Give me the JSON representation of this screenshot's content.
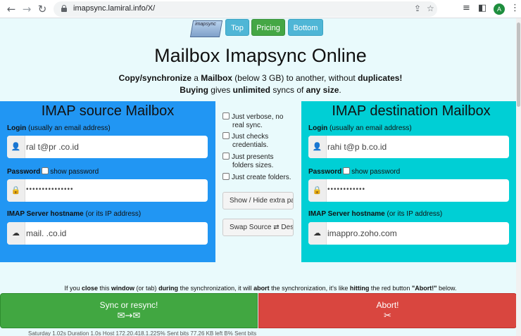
{
  "browser": {
    "url": "imapsync.lamiral.info/X/",
    "avatar_letter": "A"
  },
  "topbar": {
    "logo_text": "imapsync",
    "top": "Top",
    "pricing": "Pricing",
    "bottom": "Bottom"
  },
  "title": "Mailbox Imapsync Online",
  "subtitle": {
    "line1_a": "Copy/synchronize",
    "line1_b": " a ",
    "line1_c": "Mailbox",
    "line1_d": " (below 3 GB) to another, without ",
    "line1_e": "duplicates!",
    "line2_a": "Buying",
    "line2_b": " gives ",
    "line2_c": "unlimited",
    "line2_d": " syncs of ",
    "line2_e": "any size",
    "line2_f": "."
  },
  "source": {
    "title": "IMAP source Mailbox",
    "login_label": "Login",
    "login_hint": " (usually an email address)",
    "login_value": "ral      t@pr        .co.id",
    "password_label": "Password",
    "show_password": "show password",
    "password_value": "•••••••••••••••",
    "host_label": "IMAP Server hostname",
    "host_hint": " (or its IP address)",
    "host_value": "mail.              .co.id"
  },
  "destination": {
    "title": "IMAP destination Mailbox",
    "login_label": "Login",
    "login_hint": " (usually an email address)",
    "login_value": "rahi      t@p          b.co.id",
    "password_label": "Password",
    "show_password": "show password",
    "password_value": "••••••••••••",
    "host_label": "IMAP Server hostname",
    "host_hint": " (or its IP address)",
    "host_value": "imappro.zoho.com"
  },
  "options": {
    "verbose_1": "Just verbose, no",
    "verbose_2": "real sync.",
    "checks_1": "Just checks",
    "checks_2": "credentials.",
    "folders_1": "Just presents",
    "folders_2": "folders sizes.",
    "create": "Just create folders.",
    "show_hide": "Show / Hide extra parameters",
    "swap": "Swap Source ⇄ Destination"
  },
  "warning": {
    "a": "If you ",
    "b": "close",
    "c": " this ",
    "d": "window",
    "e": " (or tab) ",
    "f": "during",
    "g": " the synchronization, it will ",
    "h": "abort",
    "i": " the synchronization, it's like ",
    "j": "hitting",
    "k": " the red button ",
    "l": "\"Abort!\"",
    "m": " below."
  },
  "actions": {
    "sync_label": "Sync or resync!",
    "sync_glyph": "✉→✉",
    "abort_label": "Abort!",
    "abort_glyph": "✂"
  },
  "footer": "Saturday 1.02s  Duration 1.0s   Host 172.20.418.1.22S%  Sent  bits  77.26  KB  left  B%  Sent  bits"
}
